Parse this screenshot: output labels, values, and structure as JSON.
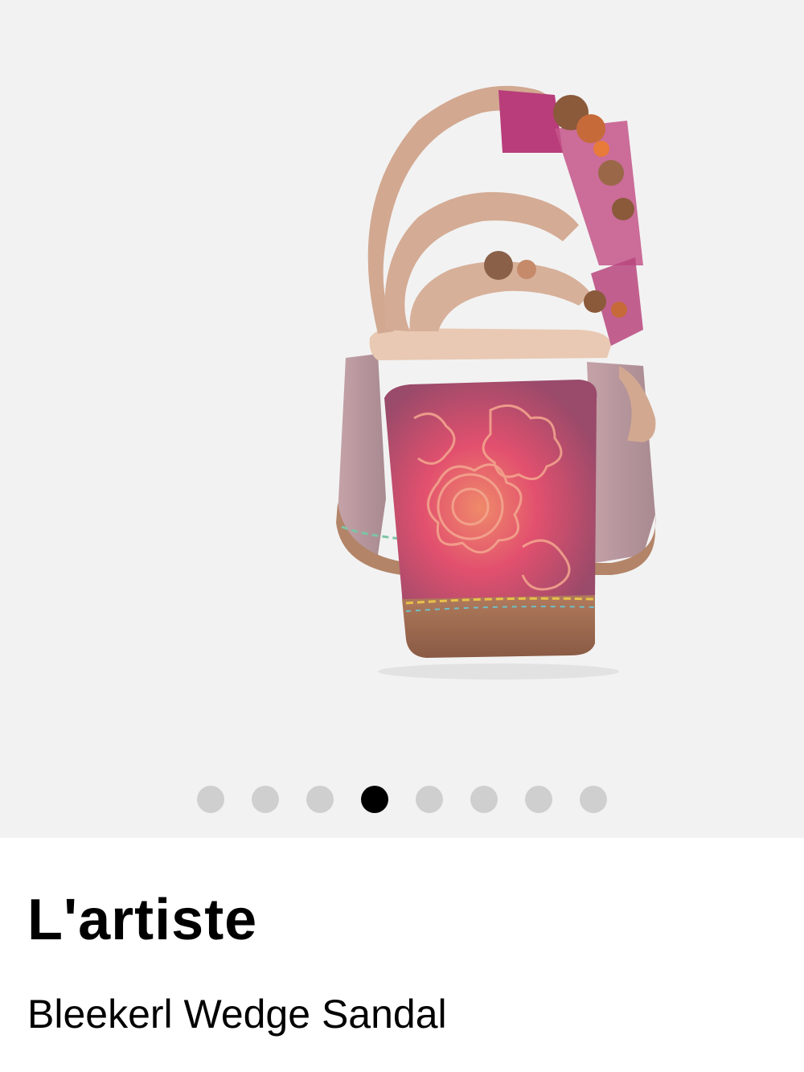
{
  "gallery": {
    "image_alt": "sandal-back-view",
    "background": "#f2f2f2",
    "dots_total": 8,
    "active_index": 3,
    "dot_color": "#cfcfcf",
    "active_dot_color": "#000000"
  },
  "product": {
    "brand": "L'artiste",
    "name": "Bleekerl Wedge Sandal"
  }
}
